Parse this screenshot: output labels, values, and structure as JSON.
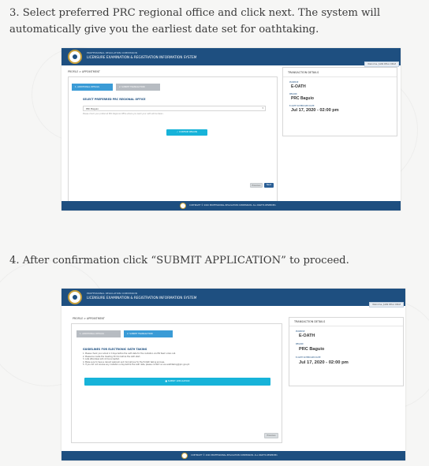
{
  "step3": {
    "text": "3.  Select preferred PRC regional office and click next. The system will automatically give you the earliest date set for oathtaking."
  },
  "step4": {
    "text": "4. After confirmation click “SUBMIT APPLICATION” to proceed."
  },
  "app": {
    "org_name": "PROFESSIONAL REGULATION COMMISSION",
    "system_name": "LICENSURE EXAMINATION & REGISTRATION INFORMATION SYSTEM",
    "welcome": "Welcome, JUAN DELA CRUZ",
    "breadcrumb": "PROFILE > APPOINTMENT",
    "footer": "COPYRIGHT © 2020 PROFESSIONAL REGULATION COMMISSION. ALL RIGHTS RESERVED."
  },
  "screen1": {
    "tabs": [
      {
        "label": "1. ADDITIONAL DETAILS"
      },
      {
        "label": "2. SUBMIT TRANSACTION"
      }
    ],
    "section_title": "SELECT PREFERRED PRC REGIONAL OFFICE",
    "select_value": "PRC Baguio",
    "hint": "Please check your preferred PRC Regional Office where you want your oath will be taken.",
    "confirm_label": "✓ CONFIRM REGION",
    "previous_label": "Previous",
    "next_label": "Next"
  },
  "screen2": {
    "tabs": [
      {
        "label": "1. ADDITIONAL DETAILS"
      },
      {
        "label": "2. SUBMIT TRANSACTION"
      }
    ],
    "section_title": "GUIDELINES FOR ELECTRONIC OATH TAKING",
    "guidelines": [
      "1. Please check your email 1-3 days before the oath date for the invitation via MS Team video call.",
      "2. Please be inside the meeting 30 min before the oath start.",
      "3. Late attendees will not be accepted.",
      "4. Make sure to have a decent webcam and microphone for the E-Oath taking process.",
      "5. If you did not receive any invitation a day before the oath date, please contact us via eoathtaking@prc.gov.ph"
    ],
    "submit_label": "■ SUBMIT APPLICATION",
    "previous_label": "Previous"
  },
  "transaction": {
    "header": "TRANSACTION DETAILS",
    "purpose_label": "PURPOSE",
    "purpose_value": "E-OATH",
    "region_label": "REGION",
    "region_value": "PRC Baguio",
    "date_label": "E-OATH SCHEDULED DATE",
    "date_value": "Jul 17, 2020 - 02:00 pm"
  },
  "colors": {
    "header_navy": "#1e4f80",
    "tab_active": "#3a9bd6",
    "button_cyan": "#17b3d9"
  }
}
